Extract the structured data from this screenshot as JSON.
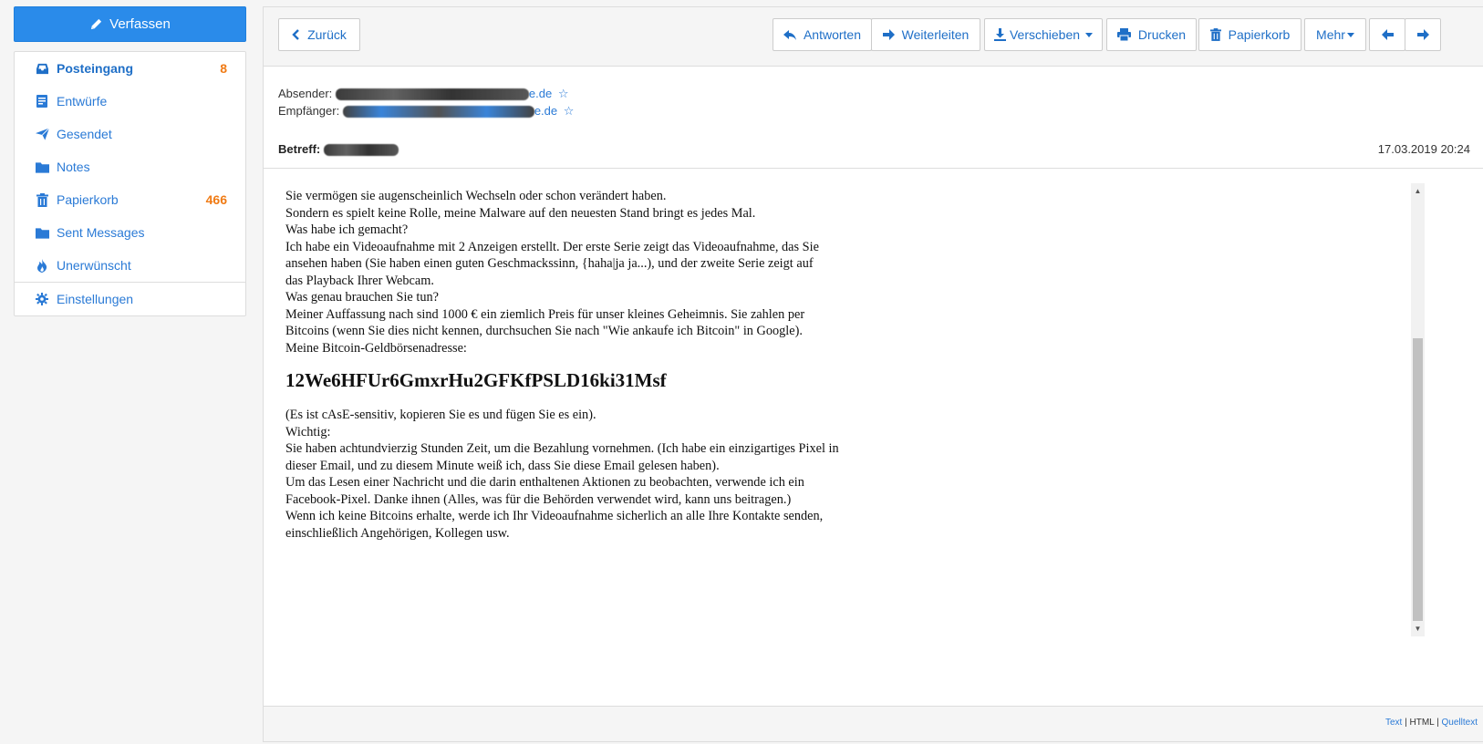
{
  "compose": {
    "label": "Verfassen",
    "icon": "pencil-icon"
  },
  "folders": [
    {
      "label": "Posteingang",
      "count": "8",
      "icon": "inbox-icon",
      "active": true
    },
    {
      "label": "Entwürfe",
      "count": "",
      "icon": "drafts-icon"
    },
    {
      "label": "Gesendet",
      "count": "",
      "icon": "send-icon"
    },
    {
      "label": "Notes",
      "count": "",
      "icon": "folder-icon"
    },
    {
      "label": "Papierkorb",
      "count": "466",
      "icon": "trash-icon"
    },
    {
      "label": "Sent Messages",
      "count": "",
      "icon": "folder-icon"
    },
    {
      "label": "Unerwünscht",
      "count": "",
      "icon": "fire-icon"
    }
  ],
  "settings": {
    "label": "Einstellungen",
    "icon": "gear-icon"
  },
  "toolbar": {
    "back": "Zurück",
    "reply": "Antworten",
    "forward": "Weiterleiten",
    "move": "Verschieben",
    "print": "Drucken",
    "trash": "Papierkorb",
    "more": "Mehr"
  },
  "header": {
    "from_label": "Absender:",
    "from_visible": "e.de",
    "to_label": "Empfänger:",
    "to_visible": "e.de",
    "subject_label": "Betreff:",
    "date": "17.03.2019 20:24"
  },
  "body": {
    "lines_top": [
      "Sie vermögen sie augenscheinlich Wechseln oder schon verändert haben.",
      "Sondern es spielt keine Rolle, meine Malware auf den neuesten Stand bringt es jedes Mal.",
      "Was habe ich gemacht?",
      "Ich habe ein Videoaufnahme mit 2 Anzeigen erstellt. Der erste Serie zeigt das Videoaufnahme, das Sie",
      "ansehen haben (Sie haben einen guten Geschmackssinn, {haha|ja ja...), und der zweite Serie zeigt auf",
      "das Playback Ihrer Webcam.",
      "Was genau brauchen Sie tun?",
      "Meiner Auffassung nach sind 1000 € ein ziemlich Preis für unser kleines Geheimnis. Sie zahlen per",
      "Bitcoins (wenn Sie dies nicht kennen, durchsuchen Sie nach \"Wie ankaufe ich Bitcoin\" in Google).",
      "Meine Bitcoin-Geldbörsenadresse:"
    ],
    "btc_address": "12We6HFUr6GmxrHu2GFKfPSLD16ki31Msf",
    "lines_bottom": [
      "(Es ist cAsE-sensitiv, kopieren Sie es und fügen Sie es ein).",
      "Wichtig:",
      "Sie haben achtundvierzig Stunden Zeit, um die Bezahlung vornehmen. (Ich habe ein einzigartiges Pixel in",
      "dieser Email, und zu diesem Minute weiß ich, dass Sie diese Email gelesen haben).",
      "Um das Lesen einer Nachricht und die darin enthaltenen Aktionen zu beobachten, verwende ich ein",
      "Facebook-Pixel. Danke ihnen (Alles, was für die Behörden verwendet wird, kann uns beitragen.)",
      "Wenn ich keine Bitcoins erhalte, werde ich Ihr Videoaufnahme sicherlich an alle Ihre Kontakte senden,",
      "einschließlich Angehörigen, Kollegen usw."
    ]
  },
  "footer": {
    "text": "Text",
    "html": "HTML",
    "source": "Quelltext",
    "sep": "|"
  },
  "colors": {
    "accent": "#2a8bea",
    "link": "#2a7ad6",
    "count": "#f07b15"
  }
}
